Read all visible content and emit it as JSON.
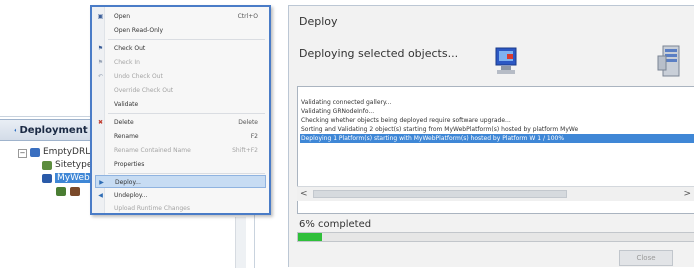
{
  "explorer": {
    "title": "Deployment",
    "close_glyph": "×",
    "tree": [
      {
        "label": "EmptyDRL",
        "expander": "−"
      },
      {
        "label": "Sitetype",
        "expander": ""
      },
      {
        "label": "MyWeb",
        "expander": ""
      }
    ]
  },
  "context_menu": {
    "items": [
      {
        "label": "Open",
        "shortcut": "Ctrl+O",
        "icon": "open-icon",
        "glyph": "▣",
        "disabled": false
      },
      {
        "label": "Open Read-Only",
        "shortcut": "",
        "icon": "",
        "glyph": "",
        "disabled": false
      },
      {
        "label": "Check Out",
        "shortcut": "",
        "icon": "check-out-icon",
        "glyph": "⚑",
        "disabled": false
      },
      {
        "label": "Check In",
        "shortcut": "",
        "icon": "check-in-icon",
        "glyph": "⚑",
        "disabled": true
      },
      {
        "label": "Undo Check Out",
        "shortcut": "",
        "icon": "undo-check-out-icon",
        "glyph": "↶",
        "disabled": true
      },
      {
        "label": "Override Check Out",
        "shortcut": "",
        "icon": "",
        "glyph": "",
        "disabled": true
      },
      {
        "label": "Validate",
        "shortcut": "",
        "icon": "",
        "glyph": "",
        "disabled": false
      },
      {
        "label": "Delete",
        "shortcut": "Delete",
        "icon": "delete-icon",
        "glyph": "✖",
        "disabled": false
      },
      {
        "label": "Rename",
        "shortcut": "F2",
        "icon": "",
        "glyph": "",
        "disabled": false
      },
      {
        "label": "Rename Contained Name",
        "shortcut": "Shift+F2",
        "icon": "",
        "glyph": "",
        "disabled": true
      },
      {
        "label": "Properties",
        "shortcut": "",
        "icon": "",
        "glyph": "",
        "disabled": false
      },
      {
        "label": "Deploy...",
        "shortcut": "",
        "icon": "deploy-icon",
        "glyph": "▶",
        "disabled": false,
        "highlight": true
      },
      {
        "label": "Undeploy...",
        "shortcut": "",
        "icon": "undeploy-icon",
        "glyph": "◀",
        "disabled": false
      },
      {
        "label": "Upload Runtime Changes",
        "shortcut": "",
        "icon": "",
        "glyph": "",
        "disabled": true
      }
    ]
  },
  "deploy_dialog": {
    "title": "Deploy",
    "subtitle": "Deploying selected objects...",
    "log_lines": [
      {
        "text": "Validating connected gallery...",
        "selected": false
      },
      {
        "text": "Validating GRNodeInfo...",
        "selected": false
      },
      {
        "text": "Checking whether objects being deployed require software upgrade...",
        "selected": false
      },
      {
        "text": "Sorting and Validating 2 object(s) starting from MyWebPlatform(s) hosted by platform MyWe",
        "selected": false
      },
      {
        "text": "Deploying 1 Platform(s) starting with MyWebPlatform(s) hosted by Platform W 1 / 100%",
        "selected": true
      }
    ],
    "scroll_left": "<",
    "scroll_right": ">",
    "progress_text": "6% completed",
    "progress_fraction": 0.06,
    "close_label": "Close",
    "accent_color": "#2fbf3a",
    "selection_color": "#3f87d6"
  }
}
